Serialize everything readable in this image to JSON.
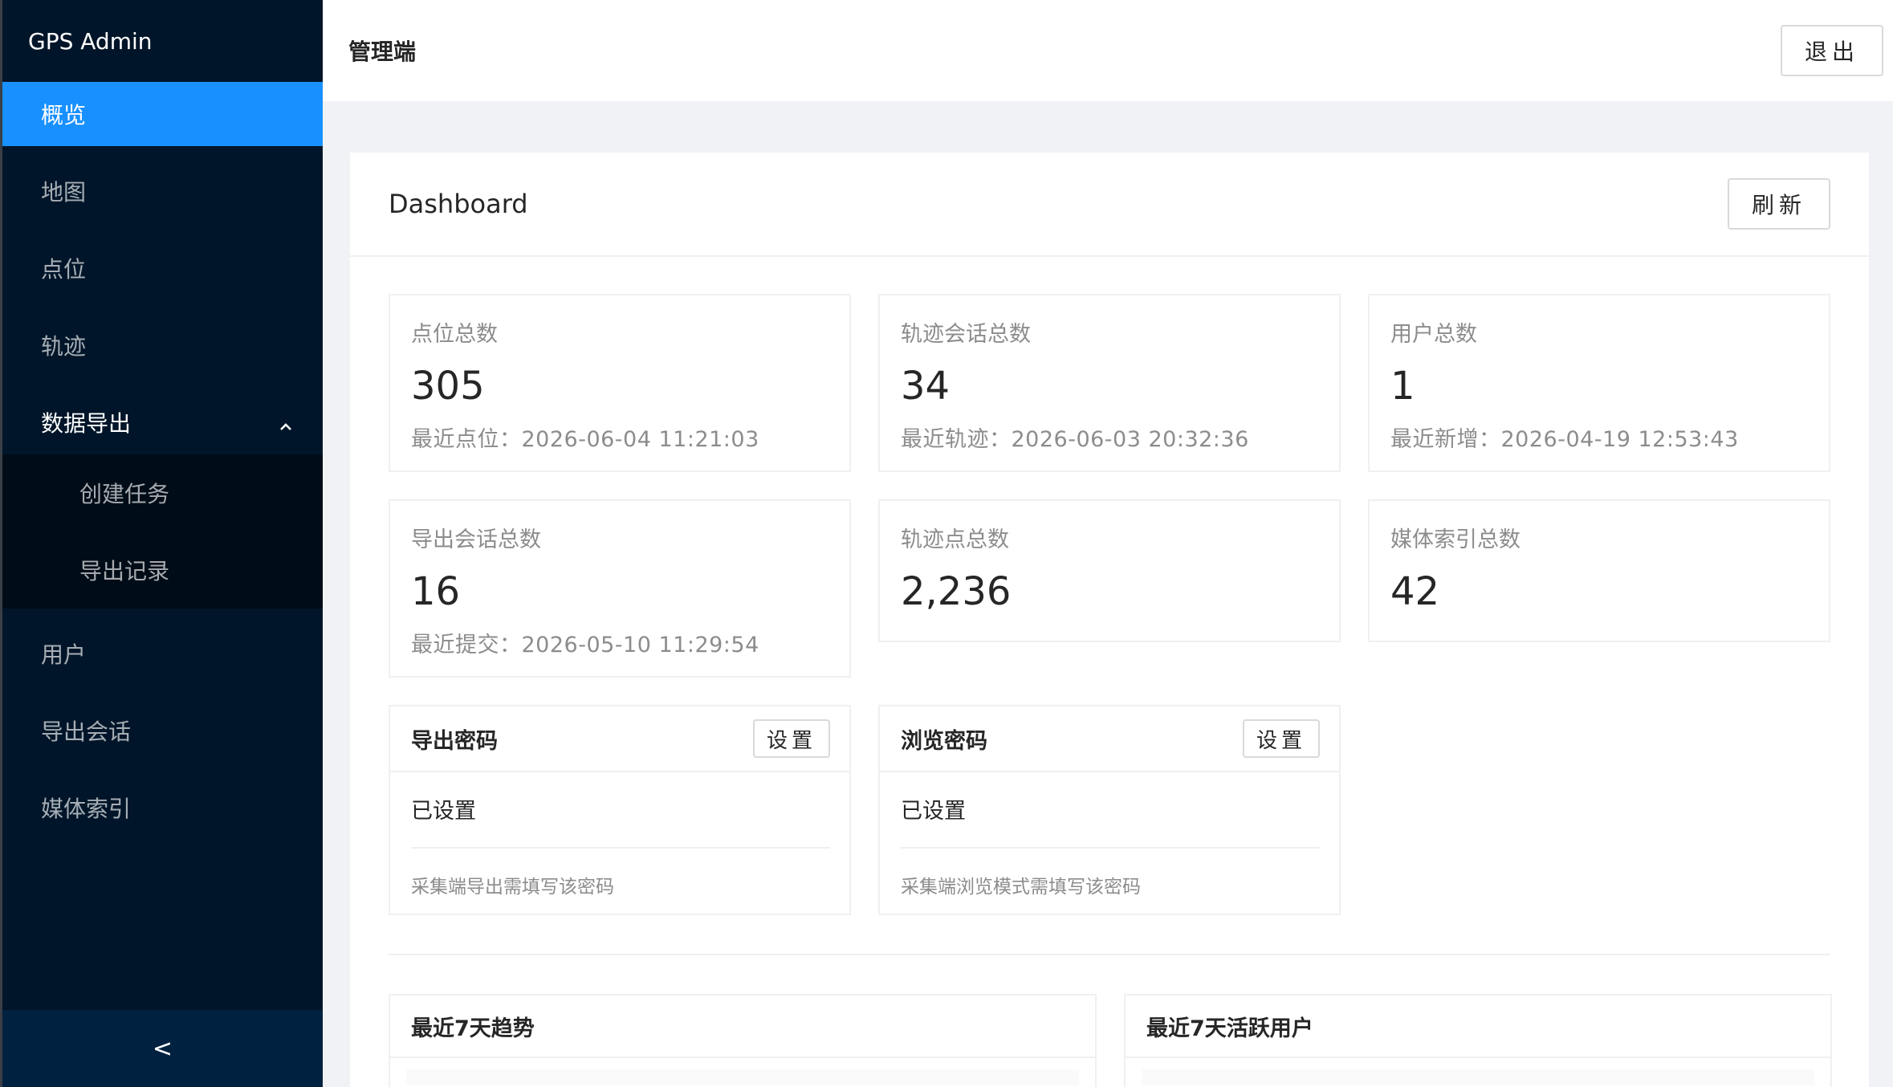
{
  "sidebar": {
    "logo": "GPS Admin",
    "items": [
      {
        "key": "overview",
        "label": "概览",
        "active": true
      },
      {
        "key": "map",
        "label": "地图"
      },
      {
        "key": "points",
        "label": "点位"
      },
      {
        "key": "tracks",
        "label": "轨迹"
      },
      {
        "key": "export",
        "label": "数据导出",
        "expanded": true
      }
    ],
    "sub_items": [
      {
        "key": "create-task",
        "label": "创建任务"
      },
      {
        "key": "export-records",
        "label": "导出记录"
      }
    ],
    "more_items": [
      {
        "key": "users",
        "label": "用户"
      },
      {
        "key": "export-sessions",
        "label": "导出会话"
      },
      {
        "key": "media-index",
        "label": "媒体索引"
      }
    ],
    "collapse_glyph": "<",
    "collapse_icon": "chevron-left-icon",
    "expand_icon": "chevron-up-icon"
  },
  "header": {
    "title": "管理端",
    "logout_label": "退出"
  },
  "dashboard": {
    "title": "Dashboard",
    "refresh_label": "刷新",
    "stats": [
      {
        "label": "点位总数",
        "value": "305",
        "sub": "最近点位：2026-06-04 11:21:03"
      },
      {
        "label": "轨迹会话总数",
        "value": "34",
        "sub": "最近轨迹：2026-06-03 20:32:36"
      },
      {
        "label": "用户总数",
        "value": "1",
        "sub": "最近新增：2026-04-19 12:53:43"
      },
      {
        "label": "导出会话总数",
        "value": "16",
        "sub": "最近提交：2026-05-10 11:29:54"
      },
      {
        "label": "轨迹点总数",
        "value": "2,236"
      },
      {
        "label": "媒体索引总数",
        "value": "42"
      }
    ],
    "passwords": [
      {
        "title": "导出密码",
        "set_label": "设置",
        "status": "已设置",
        "hint": "采集端导出需填写该密码"
      },
      {
        "title": "浏览密码",
        "set_label": "设置",
        "status": "已设置",
        "hint": "采集端浏览模式需填写该密码"
      }
    ],
    "panels": [
      {
        "title": "最近7天趋势"
      },
      {
        "title": "最近7天活跃用户"
      }
    ]
  },
  "colors": {
    "sider_bg": "#001529",
    "active_bg": "#1890ff",
    "submenu_bg": "#000c17"
  }
}
